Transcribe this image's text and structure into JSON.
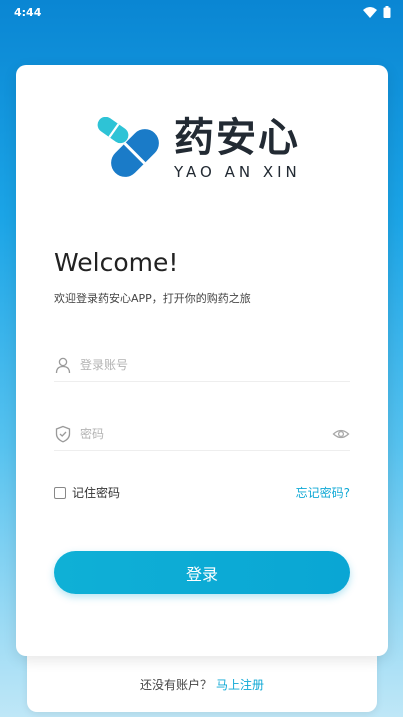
{
  "status_bar": {
    "time": "4:44",
    "icons": [
      "wifi-icon",
      "battery-icon"
    ]
  },
  "brand": {
    "name_cn": "药安心",
    "name_en": "YAO AN XIN",
    "logo_icon": "pill-capsule-icon"
  },
  "welcome": {
    "title": "Welcome!",
    "subtitle": "欢迎登录药安心APP，打开你的购药之旅"
  },
  "form": {
    "account": {
      "placeholder": "登录账号",
      "value": "",
      "icon": "user-icon"
    },
    "password": {
      "placeholder": "密码",
      "value": "",
      "icon": "shield-icon",
      "toggle_icon": "eye-icon"
    },
    "remember_label": "记住密码",
    "remember_checked": false,
    "forgot_label": "忘记密码?",
    "submit_label": "登录"
  },
  "register": {
    "prompt": "还没有账户？",
    "link": "马上注册"
  },
  "colors": {
    "accent": "#0fa8d5",
    "brand_blue": "#1a7bc8",
    "brand_teal": "#2ec3d6",
    "background_top": "#0a86d3"
  }
}
